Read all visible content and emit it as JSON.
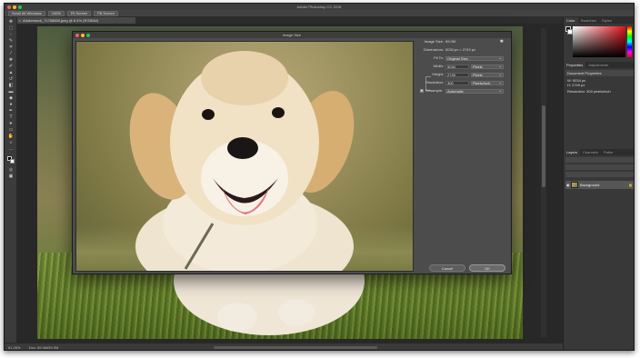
{
  "app": {
    "title": "Adobe Photoshop CC 2018"
  },
  "options_bar": {
    "buttons": [
      "Scroll All Windows",
      "100%",
      "Fit Screen",
      "Fill Screen"
    ]
  },
  "document": {
    "tab_label": "Adobestock_71758865.jpeg @ 8.4% (RGB/8#)",
    "close_glyph": "×"
  },
  "status_bar": {
    "zoom": "61.26%",
    "doc_info": "Doc: 59.0M/59.0M"
  },
  "dialog": {
    "title": "Image Size",
    "image_size_label": "Image Size:",
    "image_size_value": "59.0M",
    "dimensions_label": "Dimensions:",
    "dimensions_value": "5034 px × 2749 px",
    "fit_to_label": "Fit To:",
    "fit_to_value": "Original Size",
    "width_label": "Width:",
    "width_value": "5034",
    "width_unit": "Pixels",
    "height_label": "Height:",
    "height_value": "2749",
    "height_unit": "Pixels",
    "resolution_label": "Resolution:",
    "resolution_value": "300",
    "resolution_unit": "Pixels/Inch",
    "resample_label": "Resample:",
    "resample_value": "Automatic",
    "resample_checked": true,
    "cancel_label": "Cancel",
    "ok_label": "OK"
  },
  "panels": {
    "color_tabs": [
      "Color",
      "Swatches",
      "Styles"
    ],
    "properties_tabs": [
      "Properties",
      "Adjustments"
    ],
    "properties_title": "Document Properties",
    "properties_w": "W: 5034 px",
    "properties_h": "H: 2749 px",
    "properties_resolution": "Resolution: 300 pixels/inch",
    "layers_tabs": [
      "Layers",
      "Channels",
      "Paths"
    ],
    "layer_name": "Background"
  },
  "colors": {
    "traffic_close": "#fe5f57",
    "traffic_min": "#febc2e",
    "traffic_max": "#28c840"
  }
}
